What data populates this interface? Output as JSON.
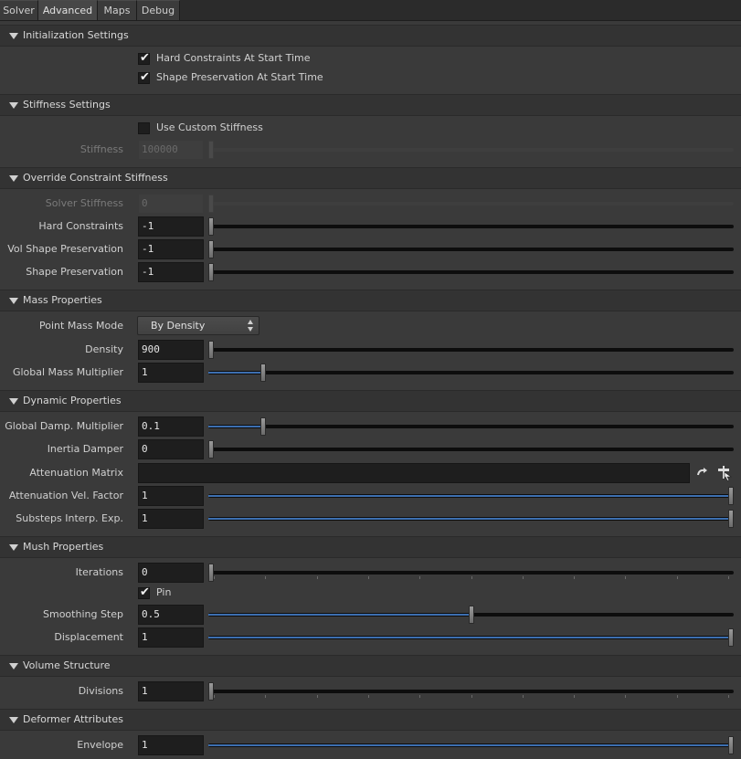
{
  "tabs": [
    {
      "label": "Solver",
      "active": false
    },
    {
      "label": "Advanced",
      "active": true
    },
    {
      "label": "Maps",
      "active": false
    },
    {
      "label": "Debug",
      "active": false
    }
  ],
  "sections": {
    "init": {
      "title": "Initialization Settings",
      "hard_constraints": {
        "label": "Hard Constraints At Start Time",
        "checked": true
      },
      "shape_preservation": {
        "label": "Shape Preservation At Start Time",
        "checked": true
      }
    },
    "stiffness": {
      "title": "Stiffness Settings",
      "use_custom": {
        "label": "Use Custom Stiffness",
        "checked": false
      },
      "stiffness": {
        "label": "Stiffness",
        "value": "100000",
        "enabled": false
      }
    },
    "override": {
      "title": "Override Constraint Stiffness",
      "solver_stiffness": {
        "label": "Solver Stiffness",
        "value": "0",
        "enabled": false
      },
      "hard_constraints": {
        "label": "Hard Constraints",
        "value": "-1"
      },
      "vol_shape_preservation": {
        "label": "Vol Shape Preservation",
        "value": "-1"
      },
      "shape_preservation": {
        "label": "Shape Preservation",
        "value": "-1"
      }
    },
    "mass": {
      "title": "Mass Properties",
      "point_mass_mode": {
        "label": "Point Mass Mode",
        "value": "By Density"
      },
      "density": {
        "label": "Density",
        "value": "900"
      },
      "global_mass_multiplier": {
        "label": "Global Mass Multiplier",
        "value": "1",
        "fraction": 0.1
      }
    },
    "dynamic": {
      "title": "Dynamic Properties",
      "global_damp_multiplier": {
        "label": "Global Damp. Multiplier",
        "value": "0.1",
        "fraction": 0.1
      },
      "inertia_damper": {
        "label": "Inertia Damper",
        "value": "0"
      },
      "attenuation_matrix": {
        "label": "Attenuation Matrix",
        "value": ""
      },
      "attenuation_vel_factor": {
        "label": "Attenuation Vel. Factor",
        "value": "1",
        "fraction": 1.0
      },
      "substeps_interp_exp": {
        "label": "Substeps Interp. Exp.",
        "value": "1",
        "fraction": 1.0
      }
    },
    "mush": {
      "title": "Mush Properties",
      "iterations": {
        "label": "Iterations",
        "value": "0"
      },
      "pin": {
        "label": "Pin",
        "checked": true
      },
      "smoothing_step": {
        "label": "Smoothing Step",
        "value": "0.5",
        "fraction": 0.5
      },
      "displacement": {
        "label": "Displacement",
        "value": "1",
        "fraction": 1.0
      }
    },
    "volume": {
      "title": "Volume Structure",
      "divisions": {
        "label": "Divisions",
        "value": "1"
      }
    },
    "deformer": {
      "title": "Deformer Attributes",
      "envelope": {
        "label": "Envelope",
        "value": "1",
        "fraction": 1.0
      }
    }
  },
  "colors": {
    "background": "#3a3a3a",
    "header": "#333333",
    "field": "#1e1e1e",
    "slider_fill": "#3d6fb0"
  }
}
